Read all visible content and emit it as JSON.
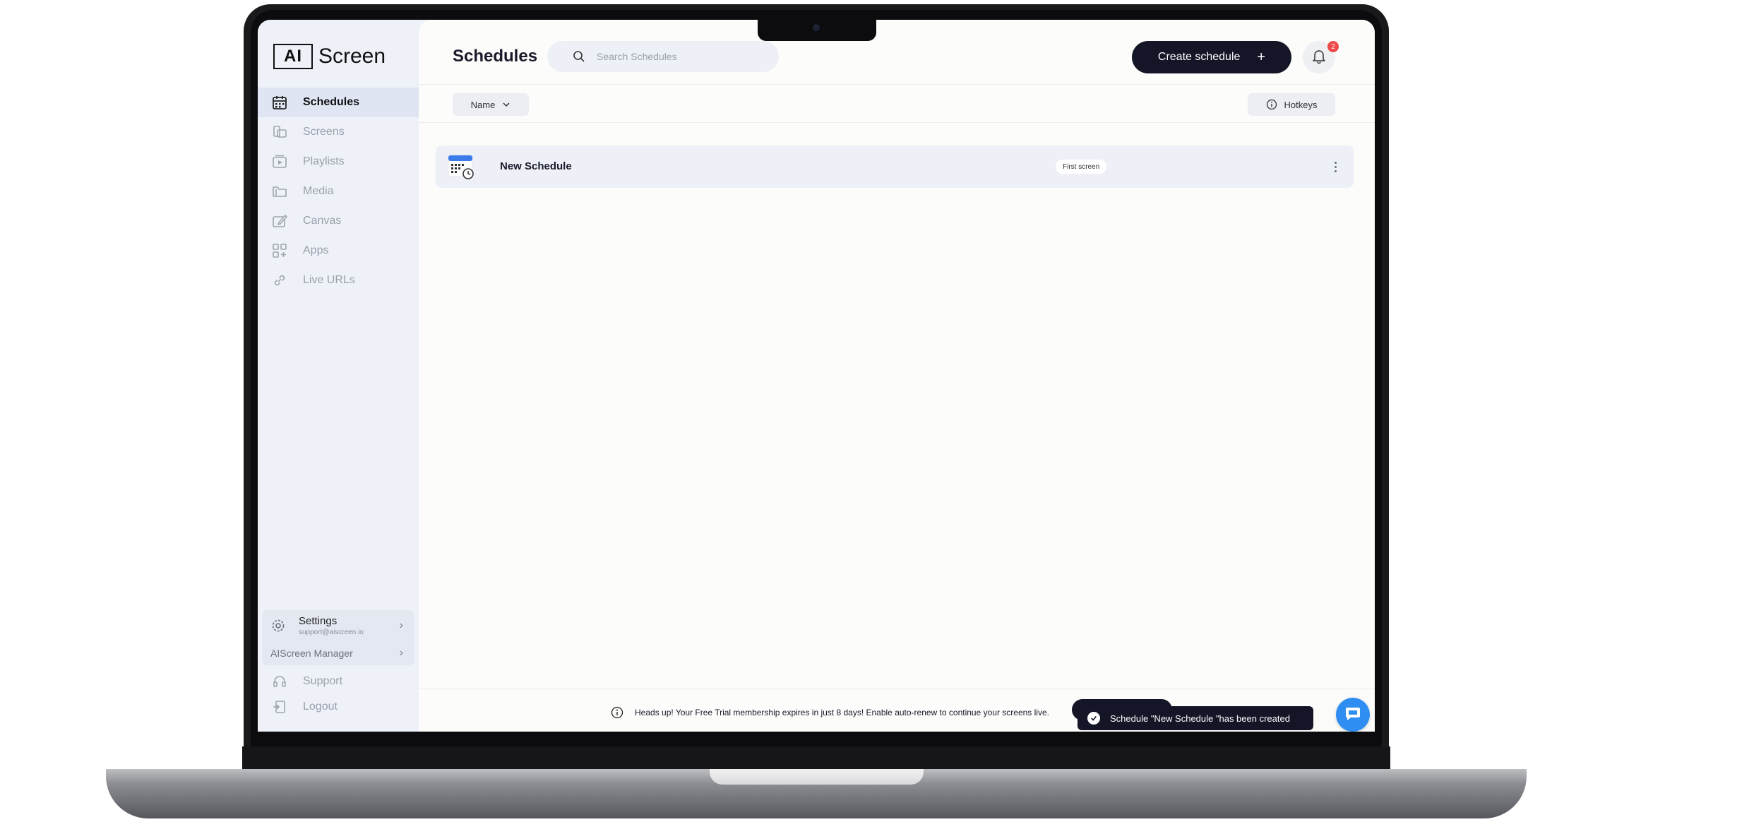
{
  "brand": {
    "logo_mark": "AI",
    "logo_text": "Screen"
  },
  "sidebar": {
    "items": [
      {
        "label": "Schedules",
        "icon": "calendar-icon",
        "active": true
      },
      {
        "label": "Screens",
        "icon": "screens-icon",
        "active": false
      },
      {
        "label": "Playlists",
        "icon": "playlist-icon",
        "active": false
      },
      {
        "label": "Media",
        "icon": "folder-icon",
        "active": false
      },
      {
        "label": "Canvas",
        "icon": "canvas-icon",
        "active": false
      },
      {
        "label": "Apps",
        "icon": "apps-icon",
        "active": false
      },
      {
        "label": "Live URLs",
        "icon": "link-icon",
        "active": false
      }
    ],
    "settings": {
      "title": "Settings",
      "email": "support@aiscreen.io"
    },
    "manager_label": "AIScreen Manager",
    "support_label": "Support",
    "logout_label": "Logout"
  },
  "header": {
    "title": "Schedules",
    "search_placeholder": "Search Schedules",
    "create_label": "Create schedule",
    "create_plus": "+",
    "notification_count": "2"
  },
  "toolbar": {
    "sort_label": "Name",
    "hotkeys_label": "Hotkeys"
  },
  "schedules": [
    {
      "name": "New Schedule",
      "tag": "First screen"
    }
  ],
  "footer": {
    "trial_message": "Heads up! Your Free Trial membership expires in just 8 days! Enable auto-renew to continue your screens live."
  },
  "toast": {
    "message": "Schedule \"New Schedule \"has been created"
  },
  "colors": {
    "primary": "#141527",
    "accent": "#2f8ef2",
    "badge": "#ef4a4a",
    "sidebar_bg": "#eef1f8"
  }
}
